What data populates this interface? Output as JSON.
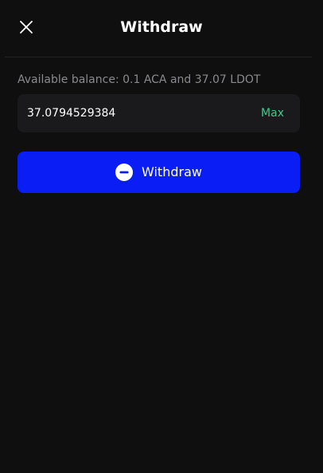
{
  "header": {
    "title": "Withdraw",
    "close_icon": "close-icon"
  },
  "balance_text": "Available balance: 0.1 ACA and 37.07 LDOT",
  "amount": {
    "value": "37.0794529384",
    "max_label": "Max"
  },
  "withdraw_button": {
    "label": "Withdraw",
    "icon": "minus-circle-icon"
  },
  "colors": {
    "background": "#0f0f10",
    "field_background": "#1a1a1c",
    "primary_button": "#0a1df5",
    "max_accent": "#3fc98a",
    "muted_text": "#8a8a8e"
  }
}
